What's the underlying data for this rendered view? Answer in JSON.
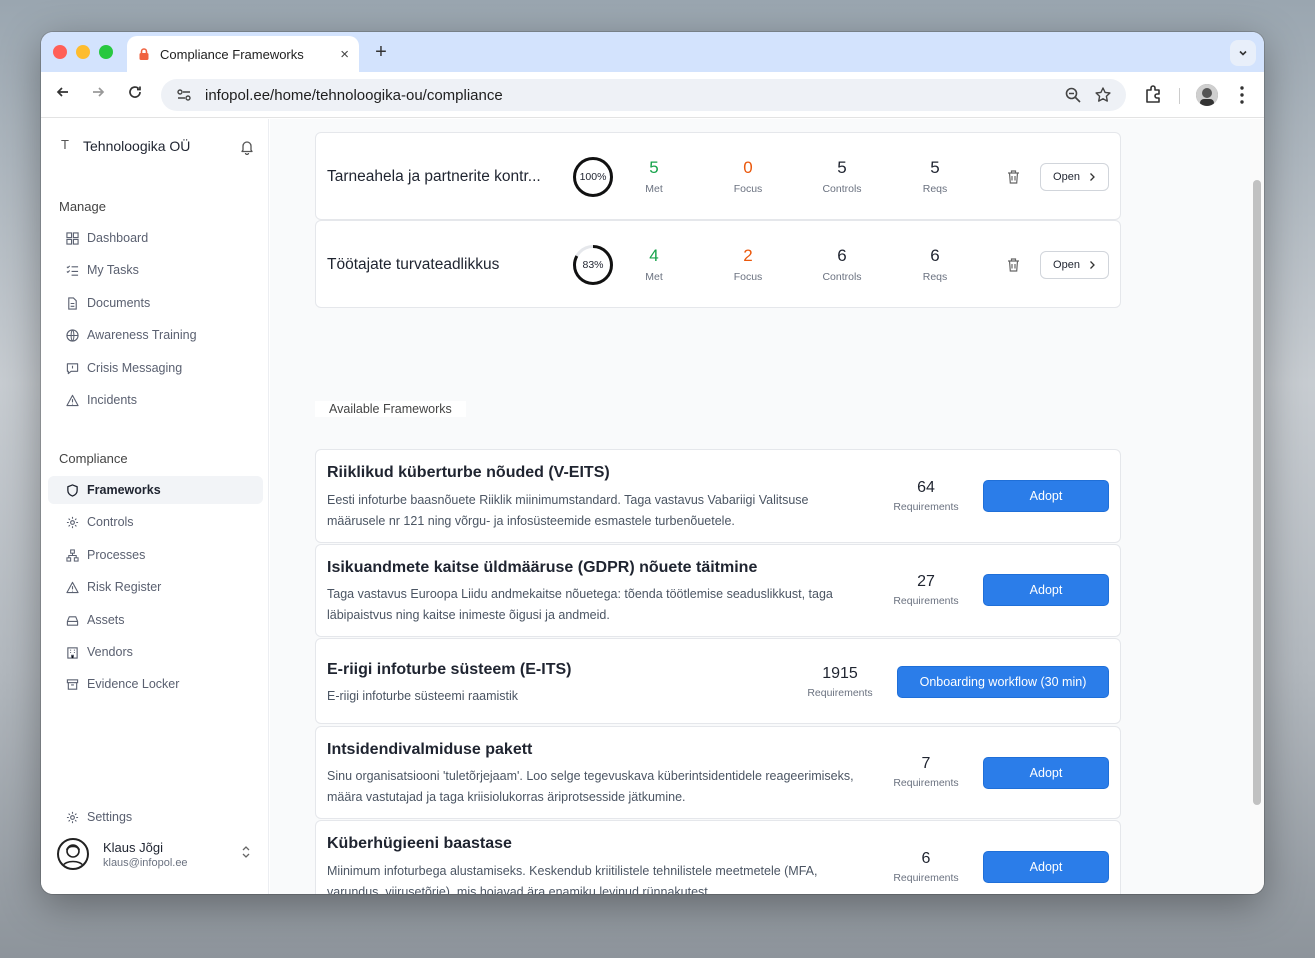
{
  "browser": {
    "tab_title": "Compliance Frameworks",
    "tab_close": "×",
    "new_tab": "+",
    "url": "infopol.ee/home/tehnoloogika-ou/compliance"
  },
  "sidebar": {
    "org_initial": "T",
    "org_name": "Tehnoloogika OÜ",
    "manage_label": "Manage",
    "manage_items": [
      {
        "label": "Dashboard",
        "icon": "grid-icon"
      },
      {
        "label": "My Tasks",
        "icon": "tasks-icon"
      },
      {
        "label": "Documents",
        "icon": "document-icon"
      },
      {
        "label": "Awareness Training",
        "icon": "globe-icon"
      },
      {
        "label": "Crisis Messaging",
        "icon": "message-icon"
      },
      {
        "label": "Incidents",
        "icon": "warning-icon"
      }
    ],
    "compliance_label": "Compliance",
    "compliance_items": [
      {
        "label": "Frameworks",
        "icon": "shield-icon",
        "active": true
      },
      {
        "label": "Controls",
        "icon": "gear-icon"
      },
      {
        "label": "Processes",
        "icon": "network-icon"
      },
      {
        "label": "Risk Register",
        "icon": "warning-icon"
      },
      {
        "label": "Assets",
        "icon": "drive-icon"
      },
      {
        "label": "Vendors",
        "icon": "building-icon"
      },
      {
        "label": "Evidence Locker",
        "icon": "archive-icon"
      }
    ],
    "settings_label": "Settings",
    "user": {
      "name": "Klaus Jõgi",
      "email": "klaus@infopol.ee"
    }
  },
  "adopted": [
    {
      "title": "Tarneahela ja partnerite kontr...",
      "progress_pct": 100,
      "progress_label": "100%",
      "met": "5",
      "met_label": "Met",
      "focus": "0",
      "focus_label": "Focus",
      "controls": "5",
      "controls_label": "Controls",
      "reqs": "5",
      "reqs_label": "Reqs",
      "open_label": "Open"
    },
    {
      "title": "Töötajate turvateadlikkus",
      "progress_pct": 83,
      "progress_label": "83%",
      "met": "4",
      "met_label": "Met",
      "focus": "2",
      "focus_label": "Focus",
      "controls": "6",
      "controls_label": "Controls",
      "reqs": "6",
      "reqs_label": "Reqs",
      "open_label": "Open"
    }
  ],
  "available_heading": "Available Frameworks",
  "available": [
    {
      "title": "Riiklikud küberturbe nõuded (V-EITS)",
      "desc": "Eesti infoturbe baasnõuete Riiklik miinimumstandard. Taga vastavus Vabariigi Valitsuse määrusele nr 121 ning võrgu- ja infosüsteemide esmastele turbenõuetele.",
      "count": "64",
      "count_label": "Requirements",
      "action": "Adopt"
    },
    {
      "title": "Isikuandmete kaitse üldmääruse (GDPR) nõuete täitmine",
      "desc": "Taga vastavus Euroopa Liidu andmekaitse nõuetega: tõenda töötlemise seaduslikkust, taga läbipaistvus ning kaitse inimeste õigusi ja andmeid.",
      "count": "27",
      "count_label": "Requirements",
      "action": "Adopt"
    },
    {
      "title": "E-riigi infoturbe süsteem (E-ITS)",
      "desc": "E-riigi infoturbe süsteemi raamistik",
      "count": "1915",
      "count_label": "Requirements",
      "action": "Onboarding workflow (30 min)"
    },
    {
      "title": "Intsidendivalmiduse pakett",
      "desc": "Sinu organisatsiooni 'tuletõrjejaam'. Loo selge tegevuskava küberintsidentidele reageerimiseks, määra vastutajad ja taga kriisiolukorras äriprotsesside jätkumine.",
      "count": "7",
      "count_label": "Requirements",
      "action": "Adopt"
    },
    {
      "title": "Küberhügieeni baastase",
      "desc": "Miinimum infoturbega alustamiseks. Keskendub kriitilistele tehnilistele meetmetele (MFA, varundus, viirusetõrje), mis hoiavad ära enamiku levinud rünnakutest.",
      "count": "6",
      "count_label": "Requirements",
      "action": "Adopt"
    }
  ],
  "colors": {
    "accent": "#2b7de9",
    "met": "#16a34a",
    "focus": "#ea580c"
  }
}
